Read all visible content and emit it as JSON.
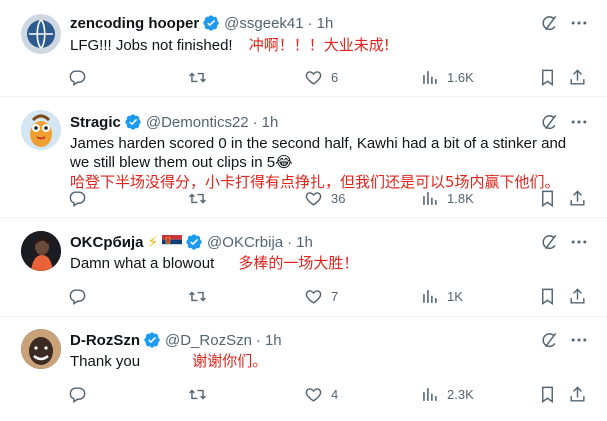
{
  "tweets": [
    {
      "name": "zencoding hooper",
      "handle": "@ssgeek41",
      "time": "1h",
      "text": "LFG!!! Jobs not finished!",
      "annotation": "冲啊！！！大业未成!",
      "replies": "",
      "reposts": "",
      "likes": "6",
      "views": "1.6K",
      "avatar_color": "#2d5b8f"
    },
    {
      "name": "Stragic",
      "handle": "@Demontics22",
      "time": "1h",
      "text_line1": "James harden scored 0 in the second half, Kawhi had a bit of a stinker and",
      "text_line2": "we still blew them out clips in 5",
      "emoji": "😂",
      "annotation": "哈登下半场没得分，小卡打得有点挣扎，但我们还是可以5场内赢下他们。",
      "replies": "",
      "reposts": "",
      "likes": "36",
      "views": "1.8K",
      "avatar_color": "#d4e6f3"
    },
    {
      "name": "OKСрбија",
      "flag_bolt": "⚡",
      "handle": "@OKCrbija",
      "time": "1h",
      "text": "Damn what a blowout",
      "annotation": "多棒的一场大胜！",
      "replies": "",
      "reposts": "",
      "likes": "7",
      "views": "1K",
      "avatar_color": "#1b1b22"
    },
    {
      "name": "D-RozSzn",
      "handle": "@D_RozSzn",
      "time": "1h",
      "text": "Thank you",
      "annotation": "谢谢你们。",
      "replies": "",
      "reposts": "",
      "likes": "4",
      "views": "2.3K",
      "avatar_color": "#3a2a22"
    }
  ],
  "colors": {
    "verified": "#1d9bf0",
    "muted": "#536471",
    "annotation": "#e0241b"
  },
  "icons": [
    "reply-icon",
    "repost-icon",
    "like-icon",
    "views-icon",
    "bookmark-icon",
    "share-icon",
    "grok-icon",
    "more-icon",
    "verified-icon"
  ]
}
